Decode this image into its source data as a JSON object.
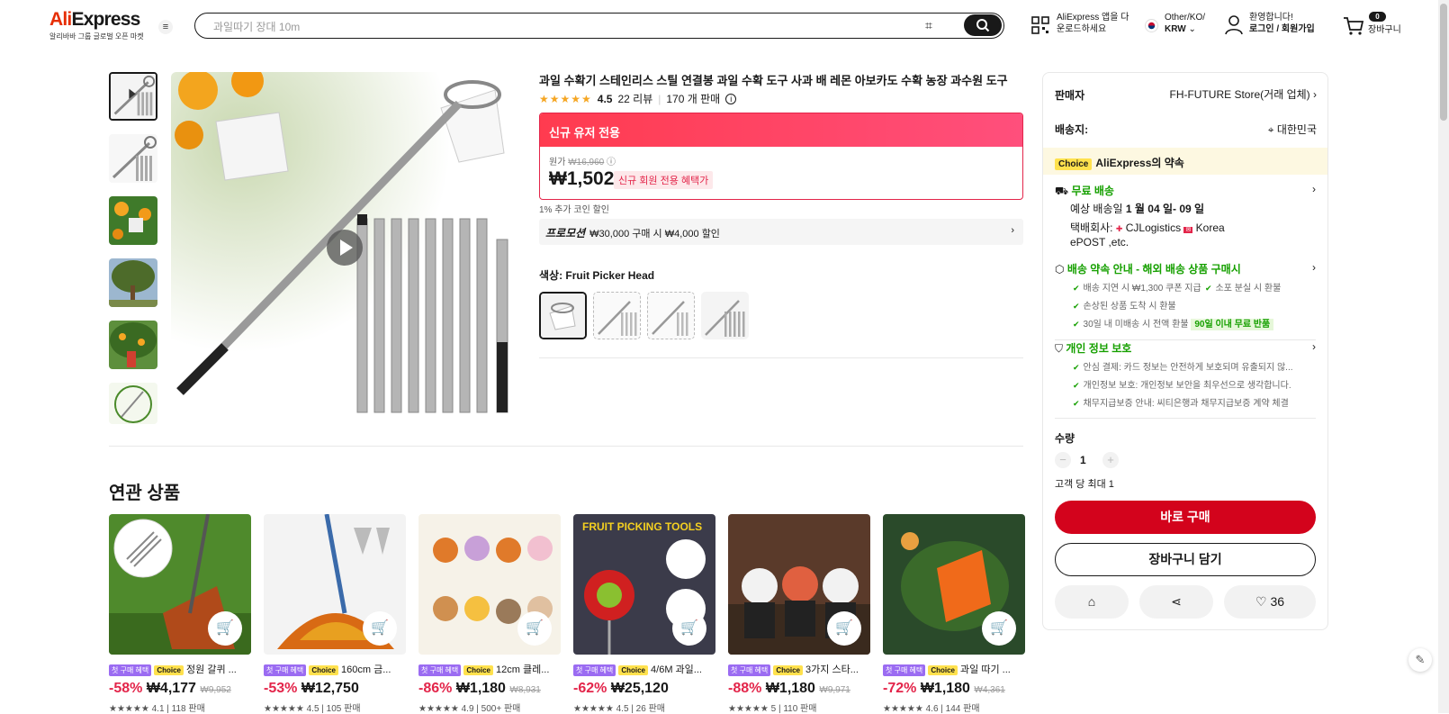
{
  "header": {
    "logo_ali": "Ali",
    "logo_express": "Express",
    "logo_sub": "알리바바 그룹 글로벌 오픈 마켓",
    "search_placeholder": "과일따기 장대 10m",
    "app_line1": "AliExpress 앱을 다",
    "app_line2": "운로드하세요",
    "locale_line1": "Other/KO/",
    "locale_line2": "KRW",
    "user_line1": "환영합니다!",
    "user_line2": "로그인 / 회원가입",
    "cart_count": "0",
    "cart_label": "장바구니"
  },
  "product": {
    "title": "과일 수확기 스테인리스 스틸 연결봉 과일 수확 도구 사과 배 레몬 아보카도 수확 농장 과수원 도구",
    "rating": "4.5",
    "reviews": "22 리뷰",
    "sold": "170 개 판매",
    "promo_header": "신규 유저 전용",
    "original_label": "원가",
    "original_price": "₩16,960",
    "price": "₩1,502",
    "price_tag": "신규 회원 전용 혜택가",
    "coin_text": "1% 추가 코인 할인",
    "promo_label": "프로모션",
    "promo_text": "₩30,000 구매 시 ₩4,000 할인",
    "color_label": "색상: Fruit Picker Head"
  },
  "panel": {
    "seller_label": "판매자",
    "seller_name": "FH-FUTURE Store(거래 업체)",
    "ship_to_label": "배송지:",
    "ship_to": "대한민국",
    "choice_tag": "Choice",
    "choice_promise": "AliExpress의 약속",
    "free_shipping": "무료 배송",
    "delivery_prefix": "예상 배송일",
    "delivery_date": "1 월 04 일- 09 일",
    "courier_label": "택배회사:",
    "courier_name1": "CJLogistics",
    "courier_name2": "Korea",
    "courier_name3": "ePOST ,etc.",
    "guarantee_title": "배송 약속 안내 - 해외 배송 상품 구매시",
    "g1": "배송 지연 시 ₩1,300 쿠폰 지급",
    "g2": "소포 분실 시 환불",
    "g3": "손상된 상품 도착 시 환불",
    "g4": "30일 내 미배송 시 전액 환불",
    "g4_tag": "90일 이내 무료 반품",
    "privacy_title": "개인 정보 보호",
    "p1": "안심 결제: 카드 정보는 안전하게 보호되며 유출되지 않...",
    "p2": "개인정보 보호: 개인정보 보안을 최우선으로 생각합니다.",
    "p3": "채무지급보증 안내: 씨티은행과 채무지급보증 계약 체결",
    "qty_label": "수량",
    "qty_value": "1",
    "qty_limit": "고객 당 최대 1",
    "buy_now": "바로 구매",
    "add_cart": "장바구니 담기",
    "wishlist_count": "36"
  },
  "related": {
    "title": "연관 상품",
    "first_tag": "첫 구매 혜택",
    "choice_tag": "Choice",
    "items": [
      {
        "name": "정원 갈퀴 ...",
        "discount": "-58%",
        "price": "₩4,177",
        "orig": "₩9,952",
        "rating": "4.1",
        "sold": "118 판매"
      },
      {
        "name": "160cm 금...",
        "discount": "-53%",
        "price": "₩12,750",
        "orig": "",
        "rating": "4.5",
        "sold": "105 판매"
      },
      {
        "name": "12cm 클레...",
        "discount": "-86%",
        "price": "₩1,180",
        "orig": "₩8,931",
        "rating": "4.9",
        "sold": "500+ 판매"
      },
      {
        "name": "4/6M 과일...",
        "discount": "-62%",
        "price": "₩25,120",
        "orig": "",
        "rating": "4.5",
        "sold": "26 판매"
      },
      {
        "name": "3가지 스타...",
        "discount": "-88%",
        "price": "₩1,180",
        "orig": "₩9,971",
        "rating": "5",
        "sold": "110 판매"
      },
      {
        "name": "과일 따기 ...",
        "discount": "-72%",
        "price": "₩1,180",
        "orig": "₩4,361",
        "rating": "4.6",
        "sold": "144 판매"
      }
    ]
  },
  "colors": {
    "accent": "#d3031c",
    "promo_gradient": "#ff3b4f",
    "choice_yellow": "#ffe14d",
    "green": "#16a000"
  }
}
